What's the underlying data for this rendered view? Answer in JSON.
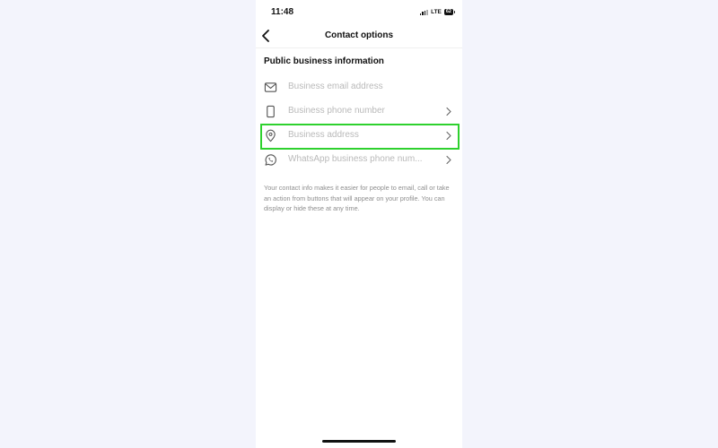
{
  "status_bar": {
    "time": "11:48",
    "network": "LTE",
    "battery": "62",
    "icons": [
      "signal-icon",
      "battery-icon"
    ]
  },
  "nav": {
    "title": "Contact options",
    "back_icon": "chevron-left-icon"
  },
  "section": {
    "title": "Public business information",
    "rows": [
      {
        "label": "Business email address",
        "icon": "mail-icon",
        "has_chevron": false
      },
      {
        "label": "Business phone number",
        "icon": "phone-icon",
        "has_chevron": true
      },
      {
        "label": "Business address",
        "icon": "location-pin-icon",
        "has_chevron": true,
        "highlighted": true
      },
      {
        "label": "WhatsApp business phone num...",
        "icon": "whatsapp-icon",
        "has_chevron": true
      }
    ]
  },
  "info_text": "Your contact info makes it easier for people to email, call or take an action from buttons that will appear on your profile. You can display or hide these at any time.",
  "colors": {
    "highlight": "#2ed12e",
    "placeholder_text": "#b9b9b9",
    "background": "#f3f4fc"
  }
}
